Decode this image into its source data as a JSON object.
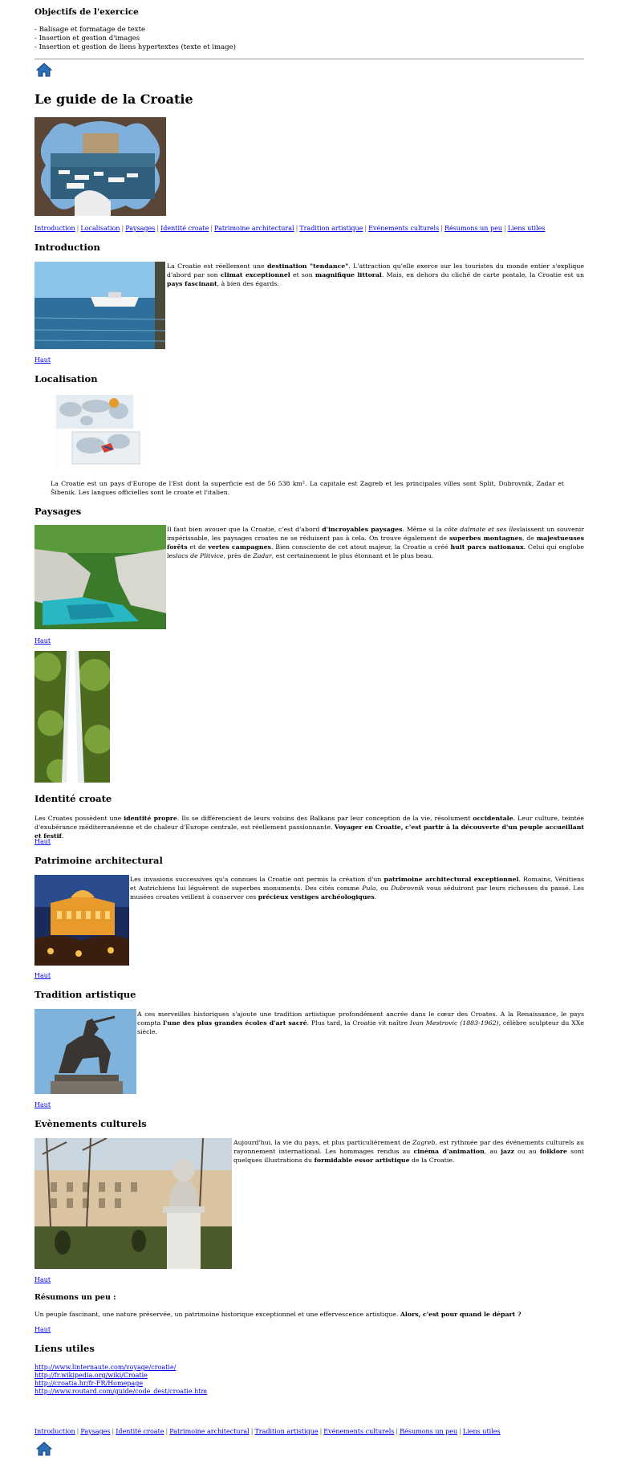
{
  "objectives": {
    "title": "Objectifs de l'exercice",
    "items": [
      "- Balisage et formatage de texte",
      "- Insertion et gestion d'images",
      "- Insertion et gestion de liens hypertextes (texte et image)"
    ]
  },
  "icons": {
    "home": "home-icon"
  },
  "page_title": "Le guide de la Croatie",
  "nav_top": [
    "Introduction",
    "Localisation",
    "Paysages",
    "Identité croate",
    "Patrimoine architectural",
    "Tradition artistique",
    "Evénements culturels",
    "Résumons un peu",
    "Liens utiles"
  ],
  "nav_bottom": [
    "Introduction",
    "Paysages",
    "Identité croate",
    "Patrimoine architectural",
    "Tradition artistique",
    "Evénements culturels",
    "Résumons un peu",
    "Liens utiles"
  ],
  "separator": "|",
  "haut_label": "Haut",
  "sections": {
    "introduction": {
      "title": "Introduction",
      "p1": "La Croatie est réellement une ",
      "b1": "destination \"tendance\"",
      "p2": ". L'attraction qu'elle exerce sur les touristes du monde entier s'explique d'abord par son ",
      "b2": "climat exceptionnel",
      "p3": " et son ",
      "b3": "magnifique littoral",
      "p4": ". Mais, en dehors du cliché de carte postale, la Croatie est un ",
      "b4": "pays fascinant",
      "p5": ", à bien des égards."
    },
    "localisation": {
      "title": "Localisation",
      "text": "La Croatie est un pays d'Europe de l'Est dont la superficie est de 56 538 km². La capitale est Zagreb et les principales villes sont Split, Dubrovnik, Zadar et Šibenik. Les langues officielles sont le croate et l'italien."
    },
    "paysages": {
      "title": "Paysages",
      "p1": "Il faut bien avouer que la Croatie, c'est d'abord ",
      "b1": "d'incroyables paysages",
      "p2": ". Même si la ",
      "i1": "côte dalmate et ses îles",
      "p3": "laissent un souvenir impérissable, les paysages croates ne se réduisent pas à cela. On trouve également de ",
      "b2": "superbes montagnes",
      "p4": ", de ",
      "b3": "majestueuses forêts",
      "p5": " et de ",
      "b4": "vertes campagnes",
      "p6": ". Bien consciente de cet atout majeur, la Croatie a créé ",
      "b5": "huit parcs nationaux",
      "p7": ". Celui qui englobe les",
      "i2": "lacs de Plitvice",
      "p8": ", près de ",
      "i3": "Zadar",
      "p9": ", est certainement le plus étonnant et le plus beau."
    },
    "identite": {
      "title": "Identité croate",
      "p1": "Les Croates possèdent une ",
      "b1": "identité propre",
      "p2": ". Ils se différencient de leurs voisins des Balkans par leur conception de la vie, résolument ",
      "b2": "occidentale",
      "p3": ". Leur culture, teintée d'exubérance méditerranéenne et de chaleur d'Europe centrale, est réellement passionnante. ",
      "b3": "Voyager en Croatie, c'est partir à la découverte d'un peuple accueillant et festif",
      "p4": "."
    },
    "patrimoine": {
      "title": "Patrimoine architectural",
      "p1": "Les invasions successives qu'a connues la Croatie ont permis la création d'un ",
      "b1": "patrimoine architectural exceptionnel",
      "p2": ". Romains, Vénitiens et Autrichiens lui léguèrent de superbes monuments. Des cités comme ",
      "i1": "Pula",
      "p3": ", ou ",
      "i2": "Dubrovnik",
      "p4": " vous séduiront par leurs richesses du passé. Les musées croates veillent à conserver ces ",
      "b2": "précieux vestiges archéologiques",
      "p5": "."
    },
    "tradition": {
      "title": "Tradition artistique",
      "p1": "A ces merveilles historiques s'ajoute une tradition artistique profondément ancrée dans le cœur des Croates. A la Renaissance, le pays compta ",
      "b1": "l'une des plus grandes écoles d'art sacré",
      "p2": ". Plus tard, la Croatie vit naître ",
      "i1": "Ivan Mestrovic (1883-1962)",
      "p3": ", célèbre sculpteur du XXe siècle."
    },
    "evenements": {
      "title": "Evènements culturels",
      "p1": "Aujourd'hui, la vie du pays, et plus particulièrement de ",
      "i1": "Zagreb",
      "p2": ", est rythmée par des événements culturels au rayonnement international. Les hommages rendus au ",
      "b1": "cinéma d'animation",
      "p3": ", au ",
      "b2": "jazz",
      "p4": " ou au ",
      "b3": "folklore",
      "p5": " sont quelques illustrations du ",
      "b4": "formidable essor artistique",
      "p6": " de la Croatie."
    },
    "resumons": {
      "title": "Résumons un peu :",
      "p1": "Un peuple fascinant, une nature préservée, un patrimoine historique exceptionnel et une effervescence artistique. ",
      "b1": "Alors, c'est pour quand le départ ?"
    },
    "liens": {
      "title": "Liens utiles",
      "items": [
        "http://www.linternaute.com/voyage/croatie/",
        "http://fr.wikipedia.org/wiki/Croatie",
        "http://croatia.hr/fr-FR/Homepage",
        "http://www.routard.com/guide/code_dest/croatie.htm"
      ]
    }
  },
  "colors": {
    "link": "#0000ee",
    "text": "#000000",
    "rule": "#999999"
  }
}
